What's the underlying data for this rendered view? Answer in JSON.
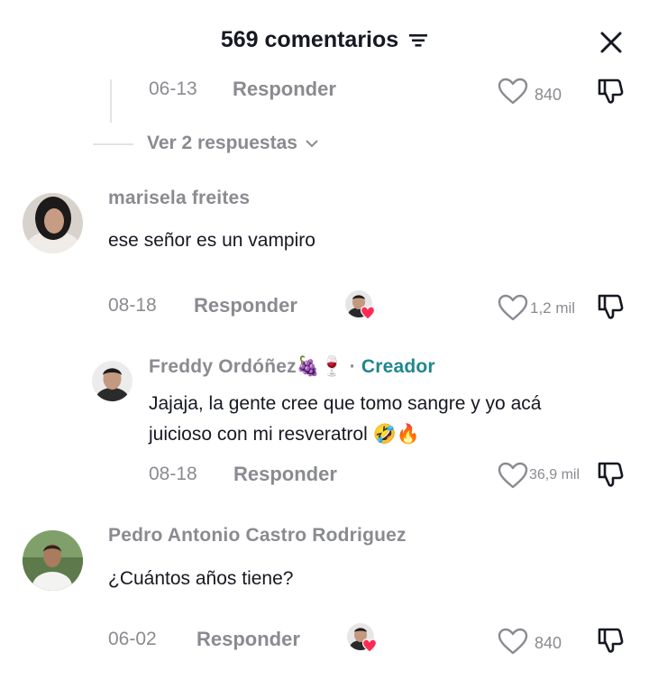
{
  "header": {
    "title": "569 comentarios",
    "filter_icon": "filter-icon",
    "close_icon": "close-icon"
  },
  "thread_top": {
    "date": "06-13",
    "reply_label": "Responder",
    "likes": "840"
  },
  "view_replies": {
    "label": "Ver 2 respuestas"
  },
  "comments": [
    {
      "username": "marisela freites",
      "text": "ese señor es un vampiro",
      "date": "08-18",
      "reply_label": "Responder",
      "likes": "1,2 mil",
      "creator_liked": true
    },
    {
      "username": "Freddy Ordóñez",
      "username_emoji": "🍇🍷",
      "separator": "·",
      "badge": "Creador",
      "text_line1": "Jajaja, la gente cree que tomo sangre y yo acá",
      "text_line2": "juicioso con mi resveratrol",
      "text_emoji": "🤣🔥",
      "date": "08-18",
      "reply_label": "Responder",
      "likes": "36,9 mil"
    },
    {
      "username": "Pedro Antonio Castro Rodriguez",
      "text": "¿Cuántos años tiene?",
      "date": "06-02",
      "reply_label": "Responder",
      "likes": "840",
      "creator_liked": true
    }
  ],
  "colors": {
    "muted": "#8a8b91",
    "text": "#161823",
    "creator": "#20878d",
    "heart_badge": "#fe2c55"
  }
}
